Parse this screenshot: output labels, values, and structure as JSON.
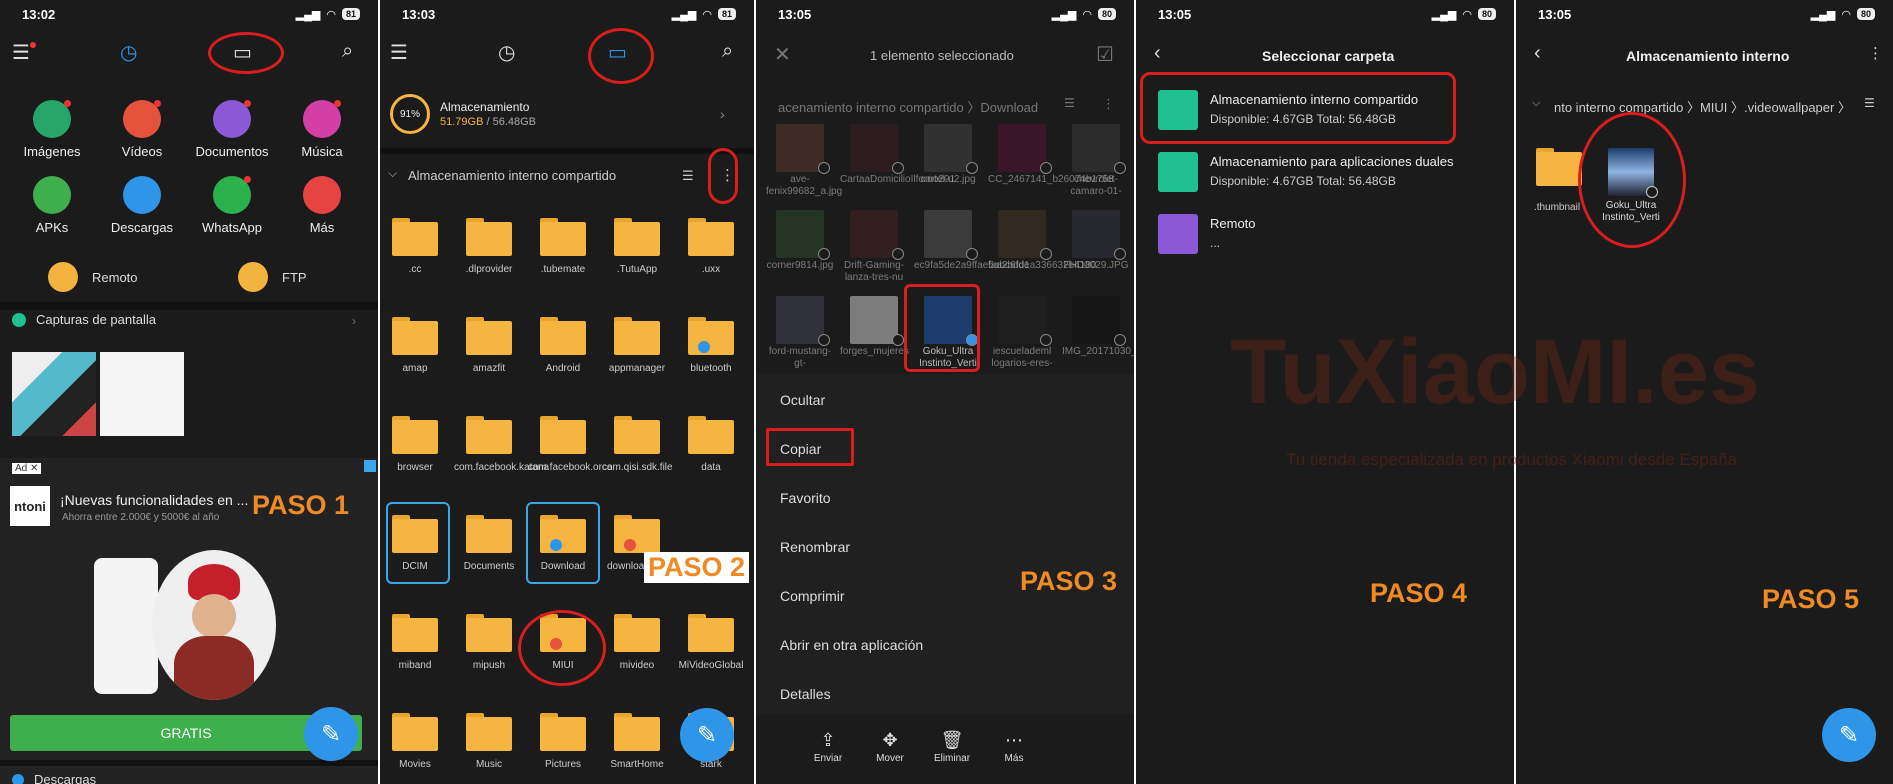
{
  "colors": {
    "accent": "#2f95e8",
    "folder": "#f6b540",
    "highlight": "#d81e1e",
    "paso": "#f08a24"
  },
  "p1": {
    "time": "13:02",
    "battery": "81",
    "categories": [
      {
        "label": "Imágenes",
        "color": "#27a56b",
        "icon": "image-icon"
      },
      {
        "label": "Vídeos",
        "color": "#e6533c",
        "icon": "video-icon"
      },
      {
        "label": "Documentos",
        "color": "#8a5ad6",
        "icon": "document-icon"
      },
      {
        "label": "Música",
        "color": "#d43fa6",
        "icon": "music-icon"
      },
      {
        "label": "APKs",
        "color": "#3fae4d",
        "icon": "android-icon"
      },
      {
        "label": "Descargas",
        "color": "#2f95e8",
        "icon": "download-icon"
      },
      {
        "label": "WhatsApp",
        "color": "#2cb24d",
        "icon": "whatsapp-icon"
      },
      {
        "label": "Más",
        "color": "#e84343",
        "icon": "grid-icon"
      }
    ],
    "remote": "Remoto",
    "ftp": "FTP",
    "screens": "Capturas de pantalla",
    "ad_tag": "Ad ✕",
    "ad_title": "¡Nuevas funcionalidades en ...",
    "ad_sub": "Ahorra entre 2.000€ y 5000€ al año",
    "ad_logo": "ntoni",
    "cta": "GRATIS",
    "bottom": "Descargas",
    "paso": "PASO 1"
  },
  "p2": {
    "time": "13:03",
    "battery": "81",
    "storage_pct": "91%",
    "storage_title": "Almacenamiento",
    "storage_used": "51.79GB",
    "storage_total": "/ 56.48GB",
    "path": "Almacenamiento interno compartido",
    "folders": [
      ".cc",
      ".dlprovider",
      ".tubemate",
      ".TutuApp",
      ".uxx",
      "amap",
      "amazfit",
      "Android",
      "appmanager",
      "bluetooth",
      "browser",
      "com.facebook.katana",
      "com.facebook.orca",
      "com.qisi.sdk.file",
      "data",
      "DCIM",
      "Documents",
      "Download",
      "downloadrom",
      "",
      "miband",
      "mipush",
      "MIUI",
      "mivideo",
      "MiVideoGlobal",
      "Movies",
      "Music",
      "Pictures",
      "SmartHome",
      "stark"
    ],
    "paso": "PASO 2"
  },
  "p3": {
    "time": "13:05",
    "battery": "80",
    "title": "1 elemento seleccionado",
    "path": "acenamiento interno compartido  〉Download",
    "files": [
      "ave-fenix99682_a.jpg",
      "CartaaDomicilioIlforno201",
      "cartel-u2.jpg",
      "CC_2467141_b26074b1758",
      "chevrolet-camaro-01-",
      "corner9814.jpg",
      "Drift-Gaming-lanza-tres-nu",
      "ec9fa5de2a9ffae5abc6fde",
      "faa2bdd1a336632b4180",
      "FHD0029.JPG",
      "ford-mustang-gt-",
      "forges_mujeres",
      "Goku_Ultra Instinto_Verti",
      "iescuelademl logarios-eres-",
      "IMG_20171030_234051.jp"
    ],
    "menu": [
      "Ocultar",
      "Copiar",
      "Favorito",
      "Renombrar",
      "Comprimir",
      "Abrir en otra aplicación",
      "Detalles"
    ],
    "actions": [
      "Enviar",
      "Mover",
      "Eliminar",
      "Más"
    ],
    "paso": "PASO 3"
  },
  "p4": {
    "time": "13:05",
    "battery": "80",
    "title": "Seleccionar carpeta",
    "items": [
      {
        "title": "Almacenamiento interno compartido",
        "sub": "Disponible: 4.67GB Total: 56.48GB",
        "color": "#1fbf8f"
      },
      {
        "title": "Almacenamiento para aplicaciones duales",
        "sub": "Disponible: 4.67GB Total: 56.48GB",
        "color": "#1fbf8f"
      },
      {
        "title": "Remoto",
        "sub": "...",
        "color": "#8a5ad6"
      }
    ],
    "paso": "PASO 4"
  },
  "p5": {
    "time": "13:05",
    "battery": "80",
    "title": "Almacenamiento interno",
    "path": "nto interno compartido 〉MIUI 〉.videowallpaper 〉",
    "thumb_label": ".thumbnail",
    "file_label": "Goku_Ultra Instinto_Verti",
    "paso": "PASO 5"
  },
  "watermark": {
    "logo": "TuXiaoMI.es",
    "tag": "Tu tienda especializada en productos Xiaomi desde España"
  }
}
